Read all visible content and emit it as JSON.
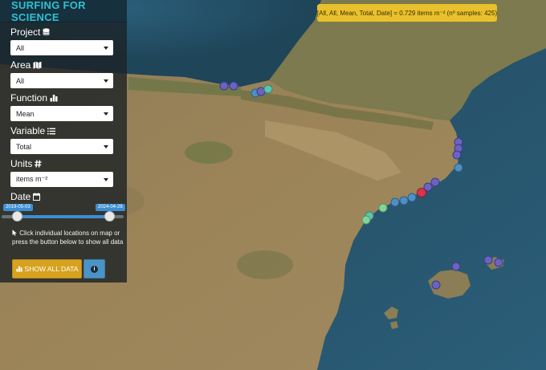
{
  "app": {
    "title": "SURFING FOR SCIENCE"
  },
  "controls": {
    "project": {
      "label": "Project",
      "icon": "database-icon",
      "value": "All"
    },
    "area": {
      "label": "Area",
      "icon": "map-icon",
      "value": "All"
    },
    "function": {
      "label": "Function",
      "icon": "bar-chart-icon",
      "value": "Mean"
    },
    "variable": {
      "label": "Variable",
      "icon": "list-icon",
      "value": "Total"
    },
    "units": {
      "label": "Units",
      "icon": "hashtag-icon",
      "value": "items m⁻²"
    },
    "date": {
      "label": "Date",
      "icon": "calendar-icon",
      "start": "2019-05-03",
      "end": "2024-04-26"
    }
  },
  "hint": {
    "icon": "cursor-pointer-icon",
    "text": "Click individual locations on map or press the button below to show all data"
  },
  "buttons": {
    "show_all": "SHOW ALL DATA",
    "show_all_icon": "bar-chart-icon",
    "info_icon": "info-icon"
  },
  "result": {
    "text": "[All, All, Mean, Total, Date] = 0.729 items m⁻² (nº samples: 425)"
  },
  "colors": {
    "title": "#2fc0d4",
    "button_primary": "#d7a21f",
    "button_info": "#4a93c6",
    "result_badge": "#e9c12c",
    "slider": "#3b8fd1",
    "marker_low": "#6a63c0",
    "marker_mid": "#4f8fc4",
    "marker_teal": "#5ec4b0",
    "marker_green": "#86d39a",
    "marker_high": "#d8344f"
  }
}
